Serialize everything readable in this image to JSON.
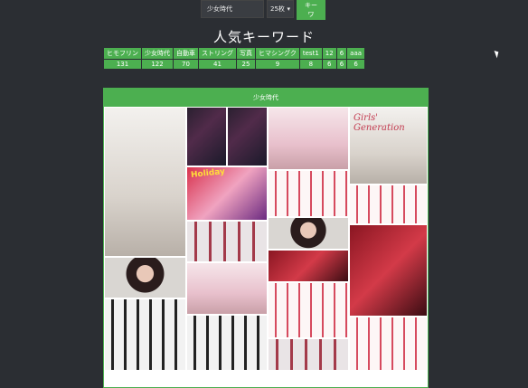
{
  "search": {
    "value": "少女時代"
  },
  "count_select": {
    "value": "25枚"
  },
  "submit_button": "キーワ",
  "heading": "人気キーワード",
  "keywords": [
    {
      "label": "ヒモフリン",
      "count": "131"
    },
    {
      "label": "少女時代",
      "count": "122"
    },
    {
      "label": "自動車",
      "count": "70"
    },
    {
      "label": "ストリング",
      "count": "41"
    },
    {
      "label": "写真",
      "count": "25"
    },
    {
      "label": "ヒマシングク",
      "count": "9"
    },
    {
      "label": "test1",
      "count": "8"
    },
    {
      "label": "12",
      "count": "6"
    },
    {
      "label": "6",
      "count": "6"
    },
    {
      "label": "aaa",
      "count": "6"
    }
  ],
  "panel_title": "少女時代",
  "photo_captions": {
    "girls_generation": "Girls' Generation",
    "holiday": "Holiday"
  }
}
